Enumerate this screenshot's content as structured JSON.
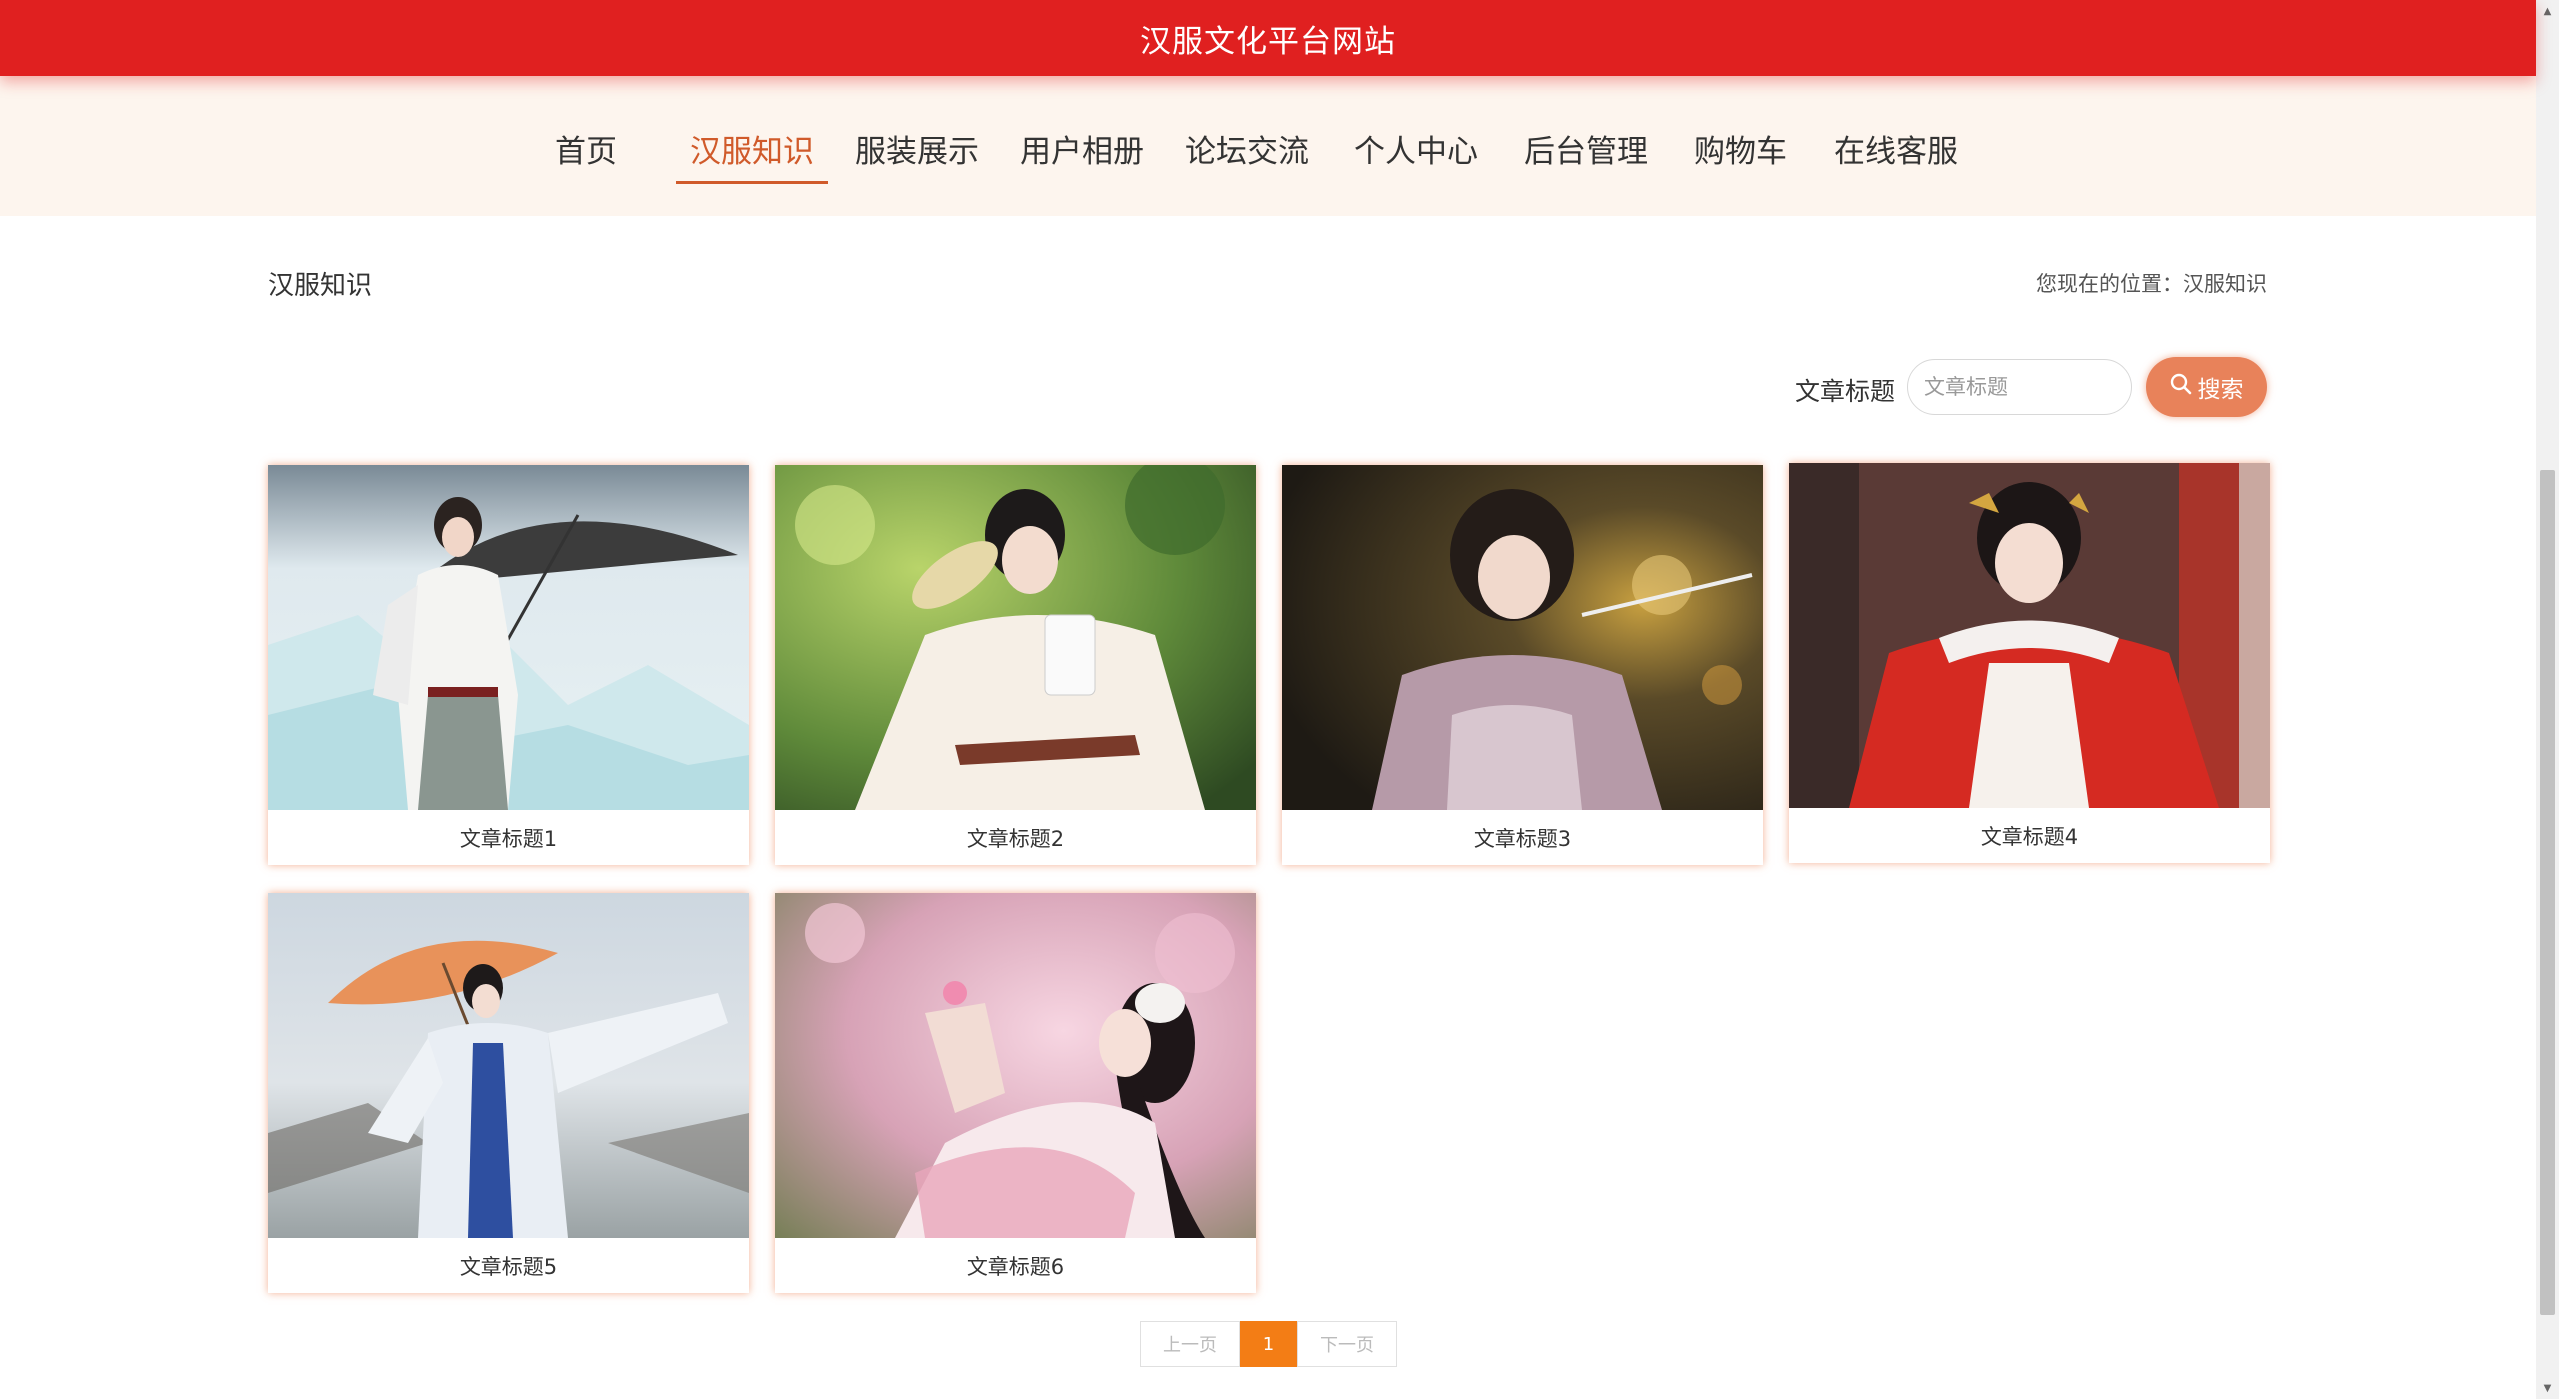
{
  "site": {
    "title": "汉服文化平台网站"
  },
  "nav": {
    "items": [
      {
        "label": "首页"
      },
      {
        "label": "汉服知识"
      },
      {
        "label": "服装展示"
      },
      {
        "label": "用户相册"
      },
      {
        "label": "论坛交流"
      },
      {
        "label": "个人中心"
      },
      {
        "label": "后台管理"
      },
      {
        "label": "购物车"
      },
      {
        "label": "在线客服"
      }
    ],
    "active": "汉服知识"
  },
  "section": {
    "title": "汉服知识",
    "breadcrumb": "您现在的位置：汉服知识"
  },
  "search": {
    "label": "文章标题",
    "placeholder": "文章标题",
    "value": "",
    "button_label": "搜索",
    "button_icon": "search-icon"
  },
  "articles": [
    {
      "title": "文章标题1",
      "image": "woman in white hanfu with paper umbrella on ice"
    },
    {
      "title": "文章标题2",
      "image": "woman in white hanfu holding fan among greenery"
    },
    {
      "title": "文章标题3",
      "image": "woman in lilac hanfu with hairpins at night"
    },
    {
      "title": "文章标题4",
      "image": "woman in red cloak hanfu by red pillars"
    },
    {
      "title": "文章标题5",
      "image": "woman in blue-white hanfu with orange umbrella"
    },
    {
      "title": "文章标题6",
      "image": "woman in pink hanfu among blossoms"
    }
  ],
  "pagination": {
    "prev_label": "上一页",
    "current_page": "1",
    "next_label": "下一页"
  },
  "colors": {
    "header_red": "#e02020",
    "nav_bg": "#fdf5ee",
    "active_accent": "#d05a2a",
    "search_button": "#e8825a",
    "pager_active": "#f37d15"
  }
}
